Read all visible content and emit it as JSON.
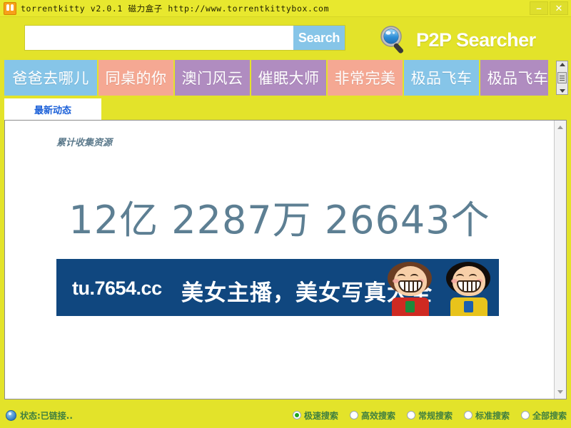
{
  "window": {
    "title": "torrentkitty v2.0.1 磁力盒子 http://www.torrentkittybox.com",
    "minimize_label": "–",
    "close_label": "✕",
    "titlebar_color": "#e8e82e",
    "chrome_color": "#e3e32a"
  },
  "search": {
    "value": "",
    "placeholder": "",
    "button_label": "Search",
    "button_color": "#86c5e8"
  },
  "brand": {
    "name": "P2P Searcher",
    "icon": "magnifier-icon"
  },
  "tabs": [
    {
      "label": "爸爸去哪儿",
      "color": "#86c5e8"
    },
    {
      "label": "同桌的你",
      "color": "#f5a893"
    },
    {
      "label": "澳门风云",
      "color": "#b08cc0"
    },
    {
      "label": "催眠大师",
      "color": "#b08cc0"
    },
    {
      "label": "非常完美",
      "color": "#f5a893"
    },
    {
      "label": "极品飞车",
      "color": "#86c5e8"
    },
    {
      "label": "极品飞车",
      "color": "#b08cc0"
    }
  ],
  "subtabs": [
    {
      "label": "最新动态",
      "active": true
    }
  ],
  "content": {
    "stat_label": "累计收集资源",
    "stat_number": "12亿 2287万 26643个",
    "stat_color": "#5d7f93",
    "banner": {
      "url": "tu.7654.cc",
      "text": "美女主播，美女写真大全",
      "background": "#10477f"
    }
  },
  "statusbar": {
    "status_text": "状态:已链接..",
    "status_icon": "connection-icon",
    "search_modes": [
      {
        "label": "极速搜索",
        "selected": true
      },
      {
        "label": "高效搜索",
        "selected": false
      },
      {
        "label": "常规搜索",
        "selected": false
      },
      {
        "label": "标准搜索",
        "selected": false
      },
      {
        "label": "全部搜索",
        "selected": false
      }
    ],
    "accent_color": "#1ea61e",
    "text_color": "#3f7f3f"
  }
}
